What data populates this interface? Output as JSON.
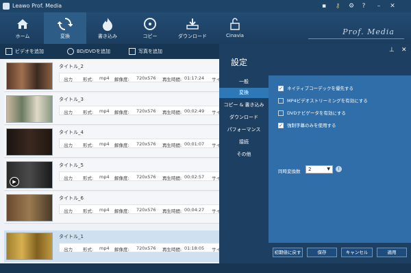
{
  "window": {
    "title": "Leawo Prof. Media"
  },
  "nav": {
    "items": [
      {
        "label": "ホーム"
      },
      {
        "label": "変換"
      },
      {
        "label": "書き込み"
      },
      {
        "label": "コピー"
      },
      {
        "label": "ダウンロード"
      },
      {
        "label": "Cinavia"
      }
    ],
    "brand": "Prof. Media"
  },
  "toolbar": {
    "add_video": "ビデオを追加",
    "add_bd_dvd": "BD/DVDを追加",
    "add_photo": "写真を追加"
  },
  "list": {
    "labels": {
      "output": "出力",
      "format": "形式:",
      "resolution": "解像度:",
      "duration": "再生時間:",
      "size": "サイズ"
    },
    "items": [
      {
        "title": "タイトル_2",
        "format": "mp4",
        "resolution": "720x576",
        "duration": "01:17:24"
      },
      {
        "title": "タイトル_3",
        "format": "mp4",
        "resolution": "720x576",
        "duration": "00:02:49"
      },
      {
        "title": "タイトル_4",
        "format": "mp4",
        "resolution": "720x576",
        "duration": "00:01:07"
      },
      {
        "title": "タイトル_5",
        "format": "mp4",
        "resolution": "720x576",
        "duration": "00:02:57"
      },
      {
        "title": "タイトル_6",
        "format": "mp4",
        "resolution": "720x576",
        "duration": "00:04:27"
      },
      {
        "title": "タイトル_1",
        "format": "mp4",
        "resolution": "720x576",
        "duration": "01:18:05"
      }
    ]
  },
  "settings": {
    "title": "設定",
    "menu": [
      {
        "label": "一般"
      },
      {
        "label": "変換"
      },
      {
        "label": "コピー & 書き込み"
      },
      {
        "label": "ダウンロード"
      },
      {
        "label": "パフォーマンス"
      },
      {
        "label": "接続"
      },
      {
        "label": "その他"
      }
    ],
    "options": [
      {
        "label": "ネイティブコーデックを優先する",
        "checked": true
      },
      {
        "label": "MP4ビデオストリーミングを有効にする",
        "checked": false
      },
      {
        "label": "DVDナビゲータを有効にする",
        "checked": false
      },
      {
        "label": "強制字幕のみを使用する",
        "checked": true
      }
    ],
    "concurrent_label": "同時変換数",
    "concurrent_value": "2",
    "buttons": {
      "reset": "初期値に戻す",
      "save": "保存",
      "cancel": "キャンセル",
      "apply": "適用"
    }
  }
}
